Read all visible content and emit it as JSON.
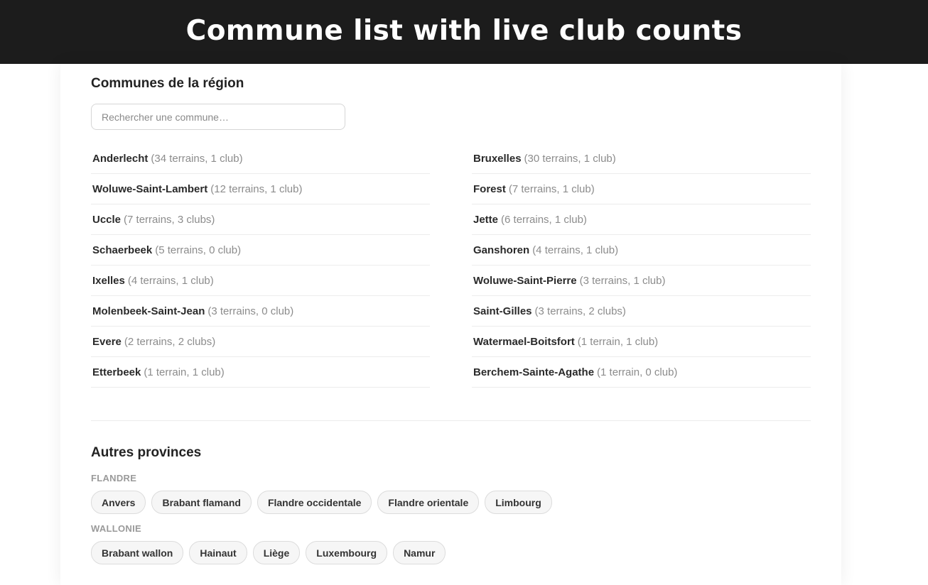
{
  "banner": {
    "title": "Commune list with live club counts"
  },
  "region": {
    "title": "Communes de la région",
    "search_placeholder": "Rechercher une commune…",
    "left": [
      {
        "name": "Anderlecht",
        "count": "(34 terrains, 1 club)"
      },
      {
        "name": "Woluwe-Saint-Lambert",
        "count": "(12 terrains, 1 club)"
      },
      {
        "name": "Uccle",
        "count": "(7 terrains, 3 clubs)"
      },
      {
        "name": "Schaerbeek",
        "count": "(5 terrains, 0 club)"
      },
      {
        "name": "Ixelles",
        "count": "(4 terrains, 1 club)"
      },
      {
        "name": "Molenbeek-Saint-Jean",
        "count": "(3 terrains, 0 club)"
      },
      {
        "name": "Evere",
        "count": "(2 terrains, 2 clubs)"
      },
      {
        "name": "Etterbeek",
        "count": "(1 terrain, 1 club)"
      }
    ],
    "right": [
      {
        "name": "Bruxelles",
        "count": "(30 terrains, 1 club)"
      },
      {
        "name": "Forest",
        "count": "(7 terrains, 1 club)"
      },
      {
        "name": "Jette",
        "count": "(6 terrains, 1 club)"
      },
      {
        "name": "Ganshoren",
        "count": "(4 terrains, 1 club)"
      },
      {
        "name": "Woluwe-Saint-Pierre",
        "count": "(3 terrains, 1 club)"
      },
      {
        "name": "Saint-Gilles",
        "count": "(3 terrains, 2 clubs)"
      },
      {
        "name": "Watermael-Boitsfort",
        "count": "(1 terrain, 1 club)"
      },
      {
        "name": "Berchem-Sainte-Agathe",
        "count": "(1 terrain, 0 club)"
      }
    ]
  },
  "provinces": {
    "title": "Autres provinces",
    "groups": [
      {
        "label": "FLANDRE",
        "items": [
          "Anvers",
          "Brabant flamand",
          "Flandre occidentale",
          "Flandre orientale",
          "Limbourg"
        ]
      },
      {
        "label": "WALLONIE",
        "items": [
          "Brabant wallon",
          "Hainaut",
          "Liège",
          "Luxembourg",
          "Namur"
        ]
      }
    ]
  }
}
